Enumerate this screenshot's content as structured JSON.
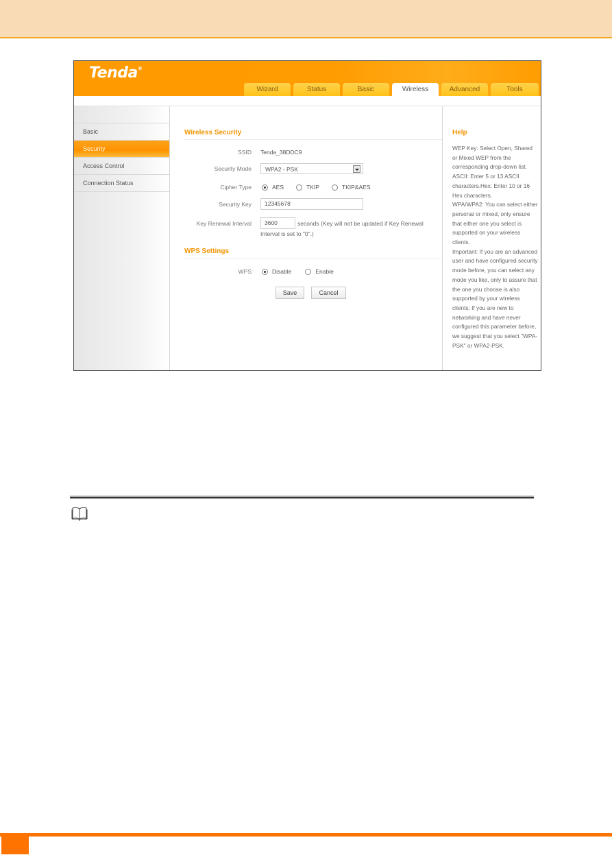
{
  "brand": {
    "logo_text": "Tenda",
    "logo_mark": "®",
    "accent_color": "#ff9c00",
    "footer_color": "#ff7300"
  },
  "nav": {
    "tabs": [
      {
        "label": "Wizard",
        "active": false
      },
      {
        "label": "Status",
        "active": false
      },
      {
        "label": "Basic",
        "active": false
      },
      {
        "label": "Wireless",
        "active": true
      },
      {
        "label": "Advanced",
        "active": false
      },
      {
        "label": "Tools",
        "active": false
      }
    ]
  },
  "sidebar": {
    "items": [
      {
        "label": "Basic",
        "active": false
      },
      {
        "label": "Security",
        "active": true
      },
      {
        "label": "Access Control",
        "active": false
      },
      {
        "label": "Connection Status",
        "active": false
      }
    ]
  },
  "wireless_security": {
    "title": "Wireless Security",
    "ssid_label": "SSID",
    "ssid_value": "Tenda_38DDC9",
    "security_mode_label": "Security Mode",
    "security_mode_value": "WPA2 - PSK",
    "cipher_label": "Cipher Type",
    "cipher_options": [
      {
        "label": "AES",
        "checked": true
      },
      {
        "label": "TKIP",
        "checked": false
      },
      {
        "label": "TKIP&AES",
        "checked": false
      }
    ],
    "key_label": "Security Key",
    "key_value": "12345678",
    "renewal_label": "Key Renewal Interval",
    "renewal_value": "3600",
    "renewal_note_line1": "seconds  (Key will not be updated if Key Renewal",
    "renewal_note_line2": "Interval is set to \"0\".)"
  },
  "wps": {
    "title": "WPS Settings",
    "label": "WPS",
    "options": [
      {
        "label": "Disable",
        "checked": true
      },
      {
        "label": "Enable",
        "checked": false
      }
    ]
  },
  "buttons": {
    "save": "Save",
    "cancel": "Cancel"
  },
  "help": {
    "title": "Help",
    "paragraphs": [
      "WEP Key: Select Open, Shared or Mixed WEP from the corresponding drop-down list. ASCII: Enter 5 or 13 ASCII characters.Hex: Enter 10 or 16 Hex characters.",
      "WPA/WPA2: You can select either personal or mixed, only ensure that either one you select is supported on your wireless clients.",
      "Important: If you are an advanced user and have configured security mode before, you can select any mode you like, only to assure that the one you choose is also supported by your wireless clients; If you are new to networking and have never configured this parameter before, we suggest that you select \"WPA-PSK\" or WPA2-PSK."
    ]
  },
  "note_section": {
    "icon": "book-icon"
  }
}
